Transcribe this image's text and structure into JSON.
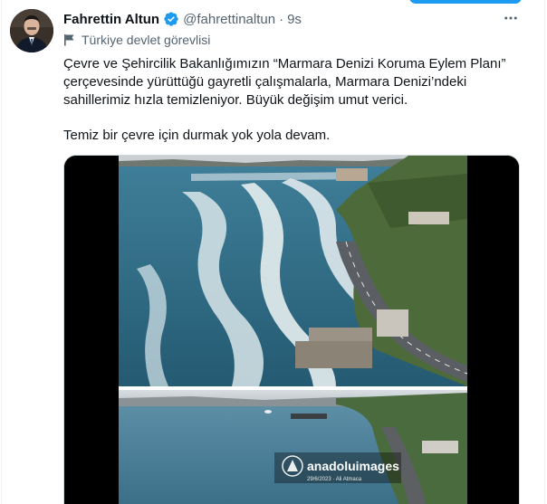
{
  "author": {
    "name": "Fahrettin Altun",
    "handle": "@fahrettinaltun",
    "time": "9s",
    "label": "Türkiye devlet görevlisi"
  },
  "tweet": {
    "lines": [
      "Çevre ve Şehircilik Bakanlığımızın “Marmara Denizi Koruma Eylem Planı”",
      "çerçevesinde yürüttüğü gayretli çalışmalarla, Marmara Denizi’ndeki",
      "sahillerimiz hızla temizleniyor. Büyük değişim umut verici."
    ],
    "closing": "Temiz bir çevre için durmak yok yola devam."
  },
  "media": {
    "watermark_brand": "anadoluimages",
    "watermark_caption": "29/6/2023 · Ali Atmaca"
  },
  "colors": {
    "accent": "#1d9bf0",
    "secondary_text": "#536471",
    "primary_text": "#0f1419"
  },
  "icons": {
    "verified": "verified-badge-icon",
    "label": "flag-icon",
    "more": "more-options-icon"
  }
}
